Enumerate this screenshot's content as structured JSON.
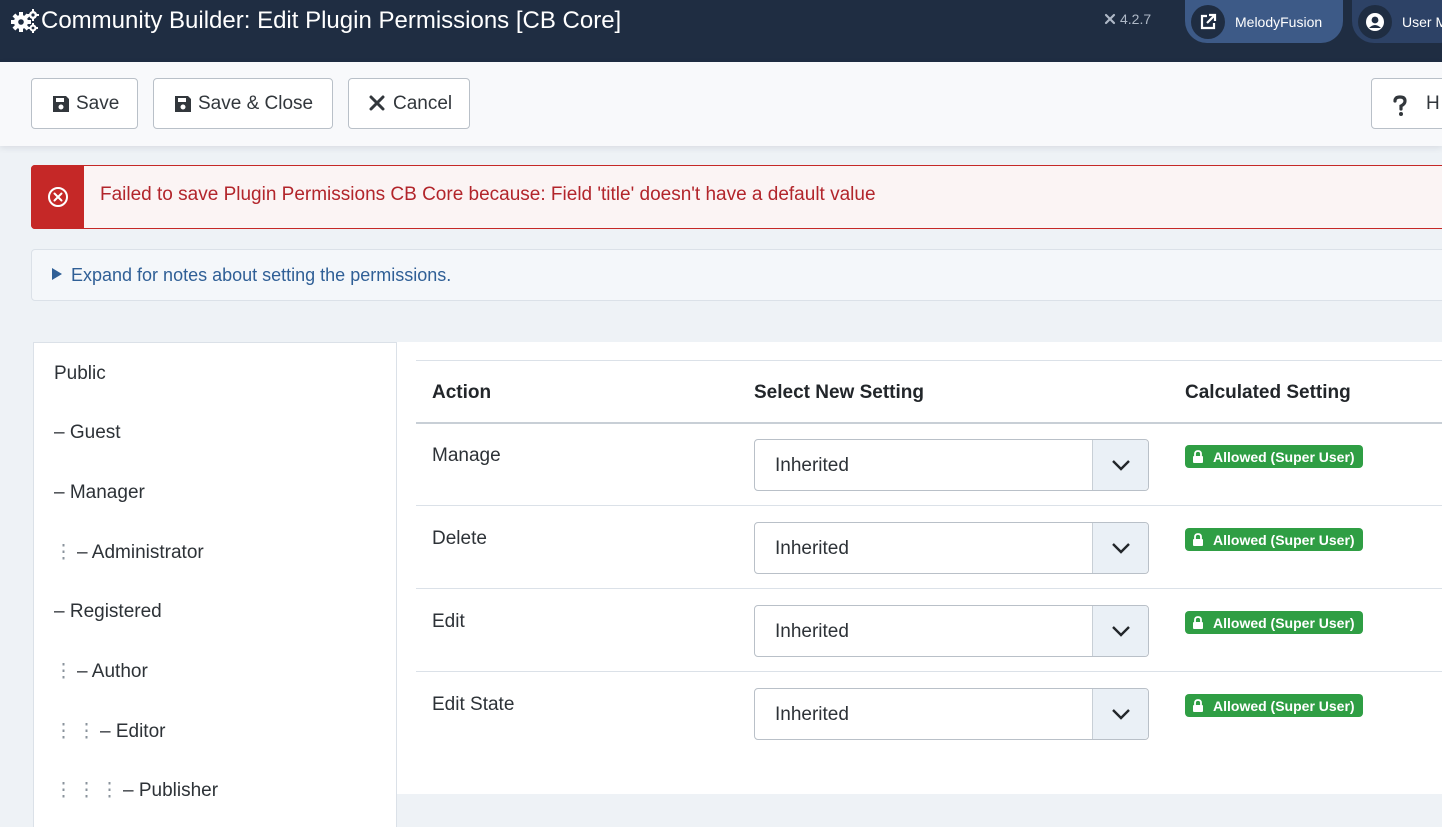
{
  "header": {
    "title": "Community Builder: Edit Plugin Permissions [CB Core]",
    "version": "4.2.7",
    "site_link_label": "MelodyFusion",
    "user_menu_label": "User M"
  },
  "toolbar": {
    "save_label": "Save",
    "save_close_label": "Save & Close",
    "cancel_label": "Cancel",
    "help_label": "H"
  },
  "alert": {
    "type": "error",
    "message": "Failed to save Plugin Permissions CB Core because: Field 'title' doesn't have a default value"
  },
  "notes": {
    "summary": "Expand for notes about setting the permissions."
  },
  "groups": [
    {
      "label": "Public",
      "depth": 0
    },
    {
      "label": "– Guest",
      "depth": 0
    },
    {
      "label": "– Manager",
      "depth": 0
    },
    {
      "label": "– Administrator",
      "depth": 1
    },
    {
      "label": "– Registered",
      "depth": 0
    },
    {
      "label": "– Author",
      "depth": 1
    },
    {
      "label": "– Editor",
      "depth": 2
    },
    {
      "label": "– Publisher",
      "depth": 3
    }
  ],
  "table": {
    "headers": {
      "action": "Action",
      "new_setting": "Select New Setting",
      "calculated": "Calculated Setting"
    },
    "rows": [
      {
        "action": "Manage",
        "setting": "Inherited",
        "calculated": "Allowed (Super User)"
      },
      {
        "action": "Delete",
        "setting": "Inherited",
        "calculated": "Allowed (Super User)"
      },
      {
        "action": "Edit",
        "setting": "Inherited",
        "calculated": "Allowed (Super User)"
      },
      {
        "action": "Edit State",
        "setting": "Inherited",
        "calculated": "Allowed (Super User)"
      }
    ]
  },
  "colors": {
    "header_bg": "#1f2d42",
    "error": "#c52827",
    "allowed_badge": "#2f9e44",
    "link": "#2f5f96"
  }
}
